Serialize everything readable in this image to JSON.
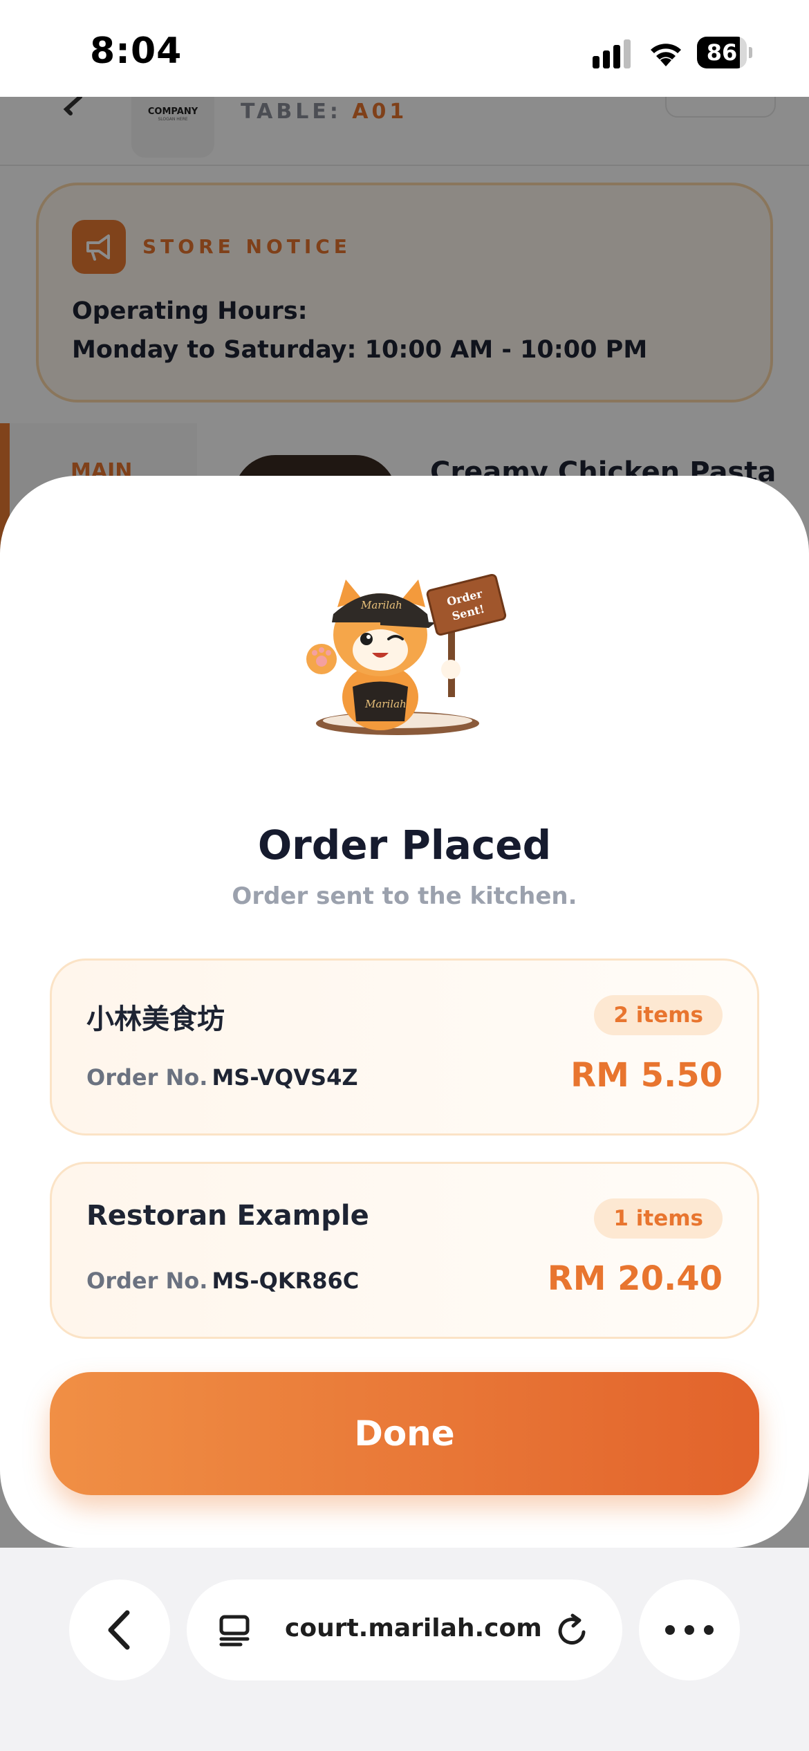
{
  "status_bar": {
    "time": "8:04",
    "battery": "86",
    "battery_level": 0.86
  },
  "background": {
    "company_logo": {
      "name": "COMPANY",
      "slogan": "SLOGAN HERE"
    },
    "table_prefix": "TABLE:",
    "table_value": "A01",
    "store_notice": {
      "title": "STORE NOTICE",
      "line1": "Operating Hours:",
      "line2": "Monday to Saturday: 10:00 AM - 10:00 PM"
    },
    "category": "MAIN",
    "dish_name": "Creamy Chicken Pasta"
  },
  "mascot": {
    "cap_text": "Marilah",
    "apron_text": "Marilah",
    "sign_text_1": "Order",
    "sign_text_2": "Sent!"
  },
  "sheet": {
    "title": "Order Placed",
    "subtitle": "Order sent to the kitchen.",
    "orders": [
      {
        "store": "小林美食坊",
        "items": "2 items",
        "order_label": "Order No.",
        "order_no": "MS-VQVS4Z",
        "amount": "RM 5.50"
      },
      {
        "store": "Restoran Example",
        "items": "1 items",
        "order_label": "Order No.",
        "order_no": "MS-QKR86C",
        "amount": "RM 20.40"
      }
    ],
    "done_label": "Done"
  },
  "browser": {
    "url": "court.marilah.com"
  },
  "colors": {
    "accent": "#ea7a32",
    "title": "#161b2e",
    "muted": "#9ba1ad"
  }
}
